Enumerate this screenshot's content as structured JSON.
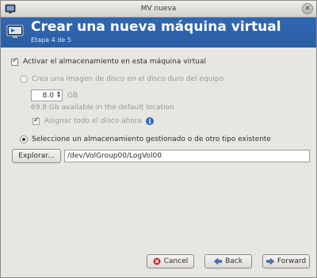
{
  "window": {
    "title": "MV nueva"
  },
  "header": {
    "title": "Crear una nueva máquina virtual",
    "subtitle": "Etapa 4 de 5"
  },
  "storage": {
    "enable_label": "Activar el almacenamiento en esta máquina virtual",
    "enable_checked": true,
    "create_disk_label": "Crea una imagen de disco en el disco duro del equipo",
    "create_disk_selected": false,
    "size_value": "8.0",
    "size_unit": "GB",
    "available_text": "69.8 Gb available in the default location",
    "allocate_label": "Asignar todo el disco ahora",
    "allocate_checked": true,
    "managed_label": "Seleccione un almacenamiento gestionado o de otro tipo existente",
    "managed_selected": true,
    "browse_label": "Explorar...",
    "path_value": "/dev/VolGroup00/LogVol00"
  },
  "buttons": {
    "cancel": "Cancel",
    "back": "Back",
    "forward": "Forward"
  },
  "icons": {
    "window": "vm-window-icon",
    "header": "vm-monitor-icon",
    "close": "close-icon",
    "info": "info-icon",
    "cancel": "cancel-icon",
    "back": "back-arrow-icon",
    "forward": "forward-arrow-icon"
  },
  "colors": {
    "header_bg": "#2c63ab",
    "header_text": "#ffffff",
    "info_icon": "#2f6bc0"
  }
}
